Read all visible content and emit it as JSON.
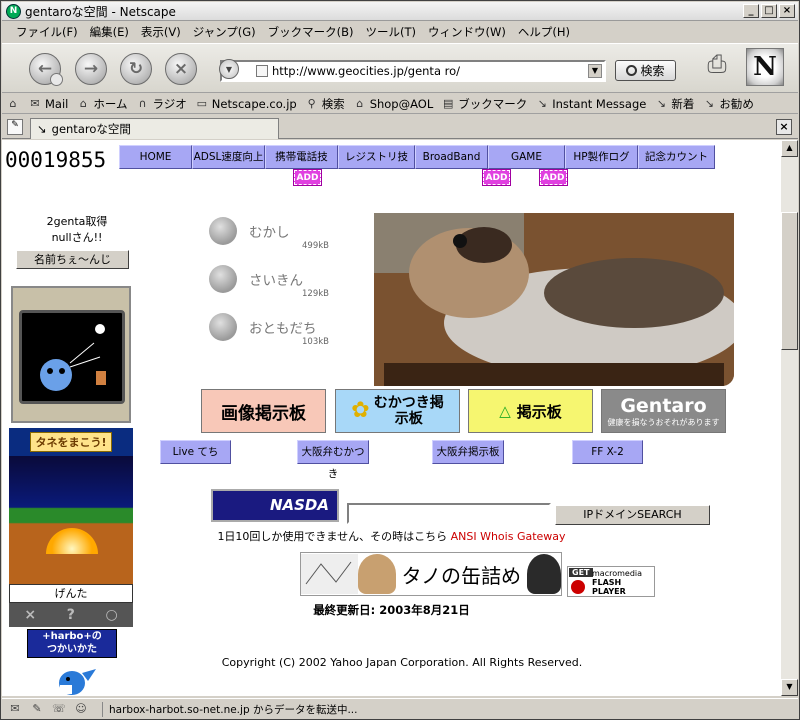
{
  "window": {
    "title": "gentaroな空間 - Netscape"
  },
  "menu": [
    "ファイル(F)",
    "編集(E)",
    "表示(V)",
    "ジャンプ(G)",
    "ブックマーク(B)",
    "ツール(T)",
    "ウィンドウ(W)",
    "ヘルプ(H)"
  ],
  "navbar": {
    "url": "http://www.geocities.jp/genta ro/",
    "search_label": "検索"
  },
  "bookmarks": [
    "Mail",
    "ホーム",
    "ラジオ",
    "Netscape.co.jp",
    "検索",
    "Shop@AOL",
    "ブックマーク",
    "Instant Message",
    "新着",
    "お勧め"
  ],
  "tab": {
    "label": "gentaroな空間"
  },
  "page": {
    "counter": "00019855",
    "nav": [
      "HOME",
      "ADSL速度向上",
      "携帯電話技",
      "レジストリ技",
      "BroadBand",
      "GAME",
      "HP製作ログ",
      "記念カウント"
    ],
    "add_badge": "ADD",
    "sidebar": {
      "line1": "2genta取得",
      "line2": "nullさん!!",
      "name_button": "名前ちぇ～んじ",
      "tane_label": "タネをまこう!",
      "genta_label": "げんた",
      "harbot_line1": "+harbo+の",
      "harbot_line2": "つかいかた"
    },
    "downloads": [
      {
        "label": "むかし",
        "size": "499kB"
      },
      {
        "label": "さいきん",
        "size": "129kB"
      },
      {
        "label": "おともだち",
        "size": "103kB"
      }
    ],
    "banners": [
      "画像掲示板",
      "むかつき掲示板",
      "掲示板",
      "Gentaro"
    ],
    "gentaro_sub": "健康を損なうおそれがあります",
    "sub_buttons": [
      "Live てち",
      "大阪弁むかつき",
      "大阪弁掲示板",
      "FF X-2"
    ],
    "nasda": "NASDA",
    "ip_button": "IPドメインSEARCH",
    "note_text": "1日10回しか使用できません、その時はこちら",
    "note_link": "ANSI Whois Gateway",
    "banner_text": "タノの缶詰め",
    "flash": {
      "get": "GET",
      "line1": "macromedia",
      "line2": "FLASH",
      "line3": "PLAYER"
    },
    "updated": "最終更新日: 2003年8月21日",
    "copyright": "Copyright (C) 2002 Yahoo Japan Corporation. All Rights Reserved."
  },
  "status": {
    "text": "harbox-harbot.so-net.ne.jp からデータを転送中..."
  }
}
